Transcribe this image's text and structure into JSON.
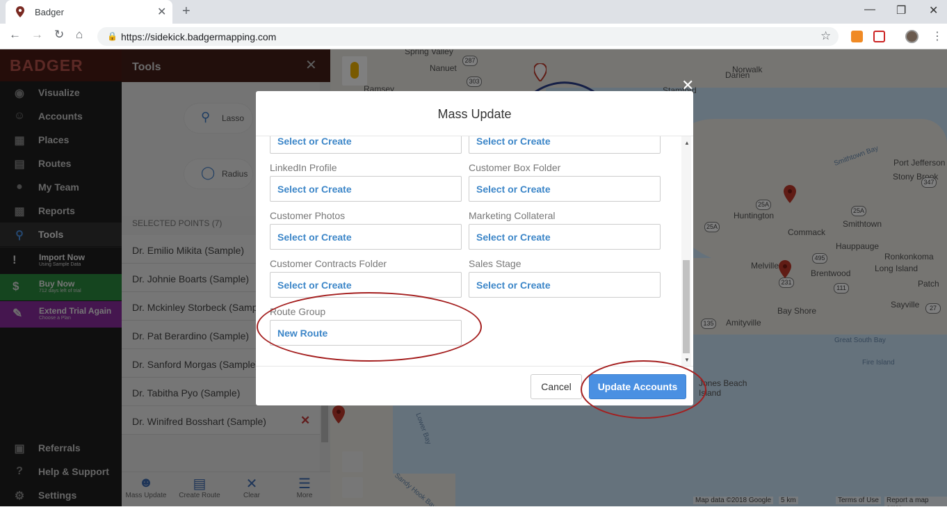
{
  "browser": {
    "tab_title": "Badger",
    "tab_close": "✕",
    "new_tab": "+",
    "url": "https://sidekick.badgermapping.com",
    "minimize": "—",
    "restore": "❐",
    "close": "✕"
  },
  "sidebar": {
    "logo": "BADGER",
    "items": [
      {
        "label": "Visualize",
        "icon": "eye-icon"
      },
      {
        "label": "Accounts",
        "icon": "person-icon"
      },
      {
        "label": "Places",
        "icon": "store-icon"
      },
      {
        "label": "Routes",
        "icon": "map-icon"
      },
      {
        "label": "My Team",
        "icon": "team-icon"
      },
      {
        "label": "Reports",
        "icon": "chart-icon"
      },
      {
        "label": "Tools",
        "icon": "lasso-icon"
      }
    ],
    "promos": [
      {
        "label": "Import Now",
        "sub": "Using Sample Data",
        "color": "#1e1e1e"
      },
      {
        "label": "Buy Now",
        "sub": "712 days left of trial",
        "color": "#2b8a3e"
      },
      {
        "label": "Extend Trial Again",
        "sub": "Choose a Plan",
        "color": "#8a2c9e"
      }
    ],
    "bottom": [
      {
        "label": "Referrals",
        "icon": "gift-icon"
      },
      {
        "label": "Help & Support",
        "icon": "help-icon"
      },
      {
        "label": "Settings",
        "icon": "gear-icon"
      }
    ]
  },
  "tools": {
    "title": "Tools",
    "lasso": "Lasso",
    "radius": "Radius",
    "selected_header": "SELECTED POINTS (7)",
    "points": [
      "Dr. Emilio Mikita (Sample)",
      "Dr. Johnie Boarts (Sample)",
      "Dr. Mckinley Storbeck (Sample)",
      "Dr. Pat Berardino (Sample)",
      "Dr. Sanford Morgas (Sample)",
      "Dr. Tabitha Pyo (Sample)",
      "Dr. Winifred Bosshart (Sample)"
    ],
    "footer": [
      "Mass Update",
      "Create Route",
      "Clear",
      "More"
    ]
  },
  "map": {
    "labels": [
      "Spring Valley",
      "Nanuet",
      "Norwalk",
      "Darien",
      "Stamford",
      "Huntington",
      "Commack",
      "Smithtown",
      "Stony Brook",
      "Port Jefferson",
      "Hauppauge",
      "Ronkonkoma",
      "Melville",
      "Brentwood",
      "Long Island",
      "Patch",
      "Bay Shore",
      "Sayville",
      "Amityville",
      "Great South Bay",
      "Fire Island",
      "Jones Beach Island",
      "Lower Bay",
      "Sandy Hook Bay",
      "Smithtown Bay",
      "Ramsey"
    ],
    "routes": [
      "287",
      "303",
      "25A",
      "25A",
      "25A",
      "347",
      "495",
      "231",
      "111",
      "135",
      "27"
    ],
    "copyright": [
      "Map data ©2018 Google",
      "5 km",
      "Terms of Use",
      "Report a map error"
    ]
  },
  "modal": {
    "title": "Mass Update",
    "close": "✕",
    "fields": [
      {
        "label": "",
        "value": "Select or Create"
      },
      {
        "label": "",
        "value": "Select or Create"
      },
      {
        "label": "LinkedIn Profile",
        "value": "Select or Create"
      },
      {
        "label": "Customer Box Folder",
        "value": "Select or Create"
      },
      {
        "label": "Customer Photos",
        "value": "Select or Create"
      },
      {
        "label": "Marketing Collateral",
        "value": "Select or Create"
      },
      {
        "label": "Customer Contracts Folder",
        "value": "Select or Create"
      },
      {
        "label": "Sales Stage",
        "value": "Select or Create"
      },
      {
        "label": "Route Group",
        "value": "New Route"
      }
    ],
    "cancel": "Cancel",
    "update": "Update Accounts",
    "annotation_color": "#a41e1e"
  }
}
